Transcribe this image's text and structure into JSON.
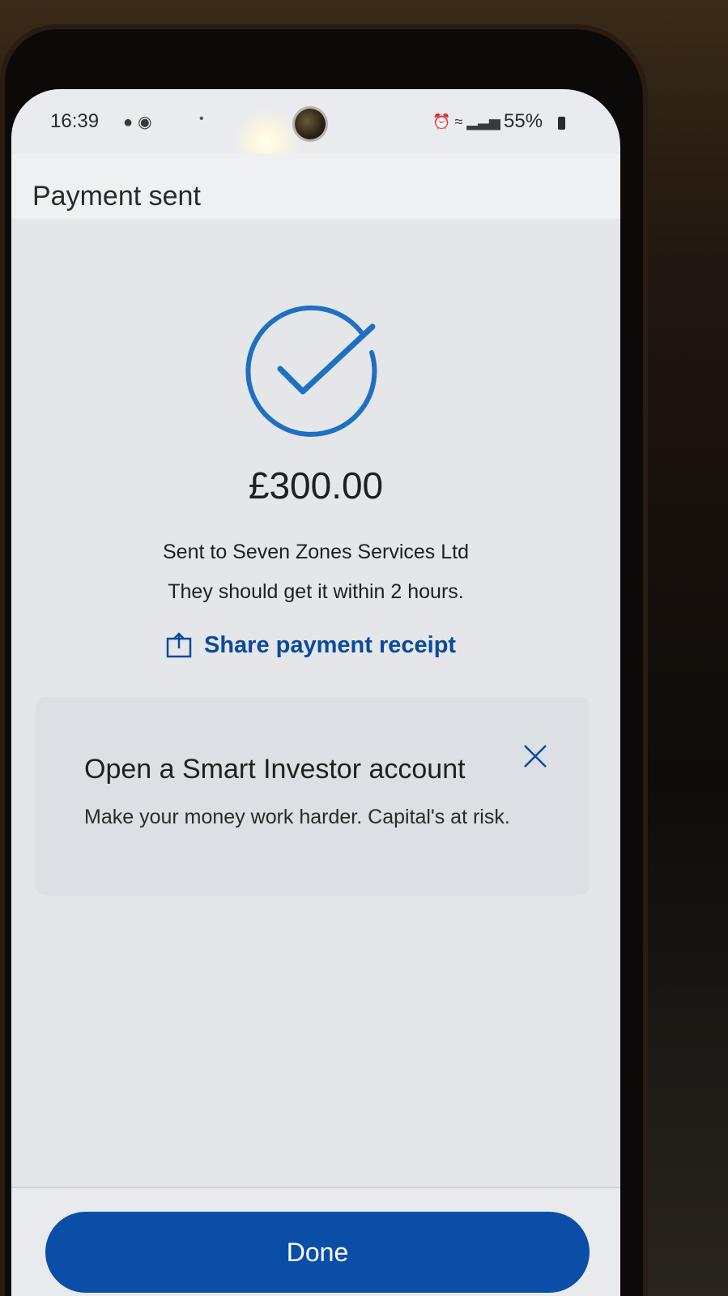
{
  "status_bar": {
    "time": "16:39",
    "battery": "55%",
    "notification_icons": [
      "chat-icon",
      "app-icon"
    ],
    "right_icons": [
      "alarm-icon",
      "wifi-icon",
      "signal-icon"
    ]
  },
  "header": {
    "title": "Payment sent"
  },
  "confirmation": {
    "icon": "check-circle-icon",
    "amount": "£300.00",
    "recipient_line": "Sent to Seven Zones Services Ltd",
    "eta_line": "They should get it within 2 hours.",
    "share_label": "Share payment receipt"
  },
  "promo": {
    "title": "Open a Smart Investor account",
    "subtitle": "Make your money work harder. Capital's at risk.",
    "close_icon": "close-icon"
  },
  "footer": {
    "done_label": "Done"
  },
  "colors": {
    "accent": "#0b4ea8",
    "link": "#0a4a9c",
    "check": "#1f6fc2"
  }
}
